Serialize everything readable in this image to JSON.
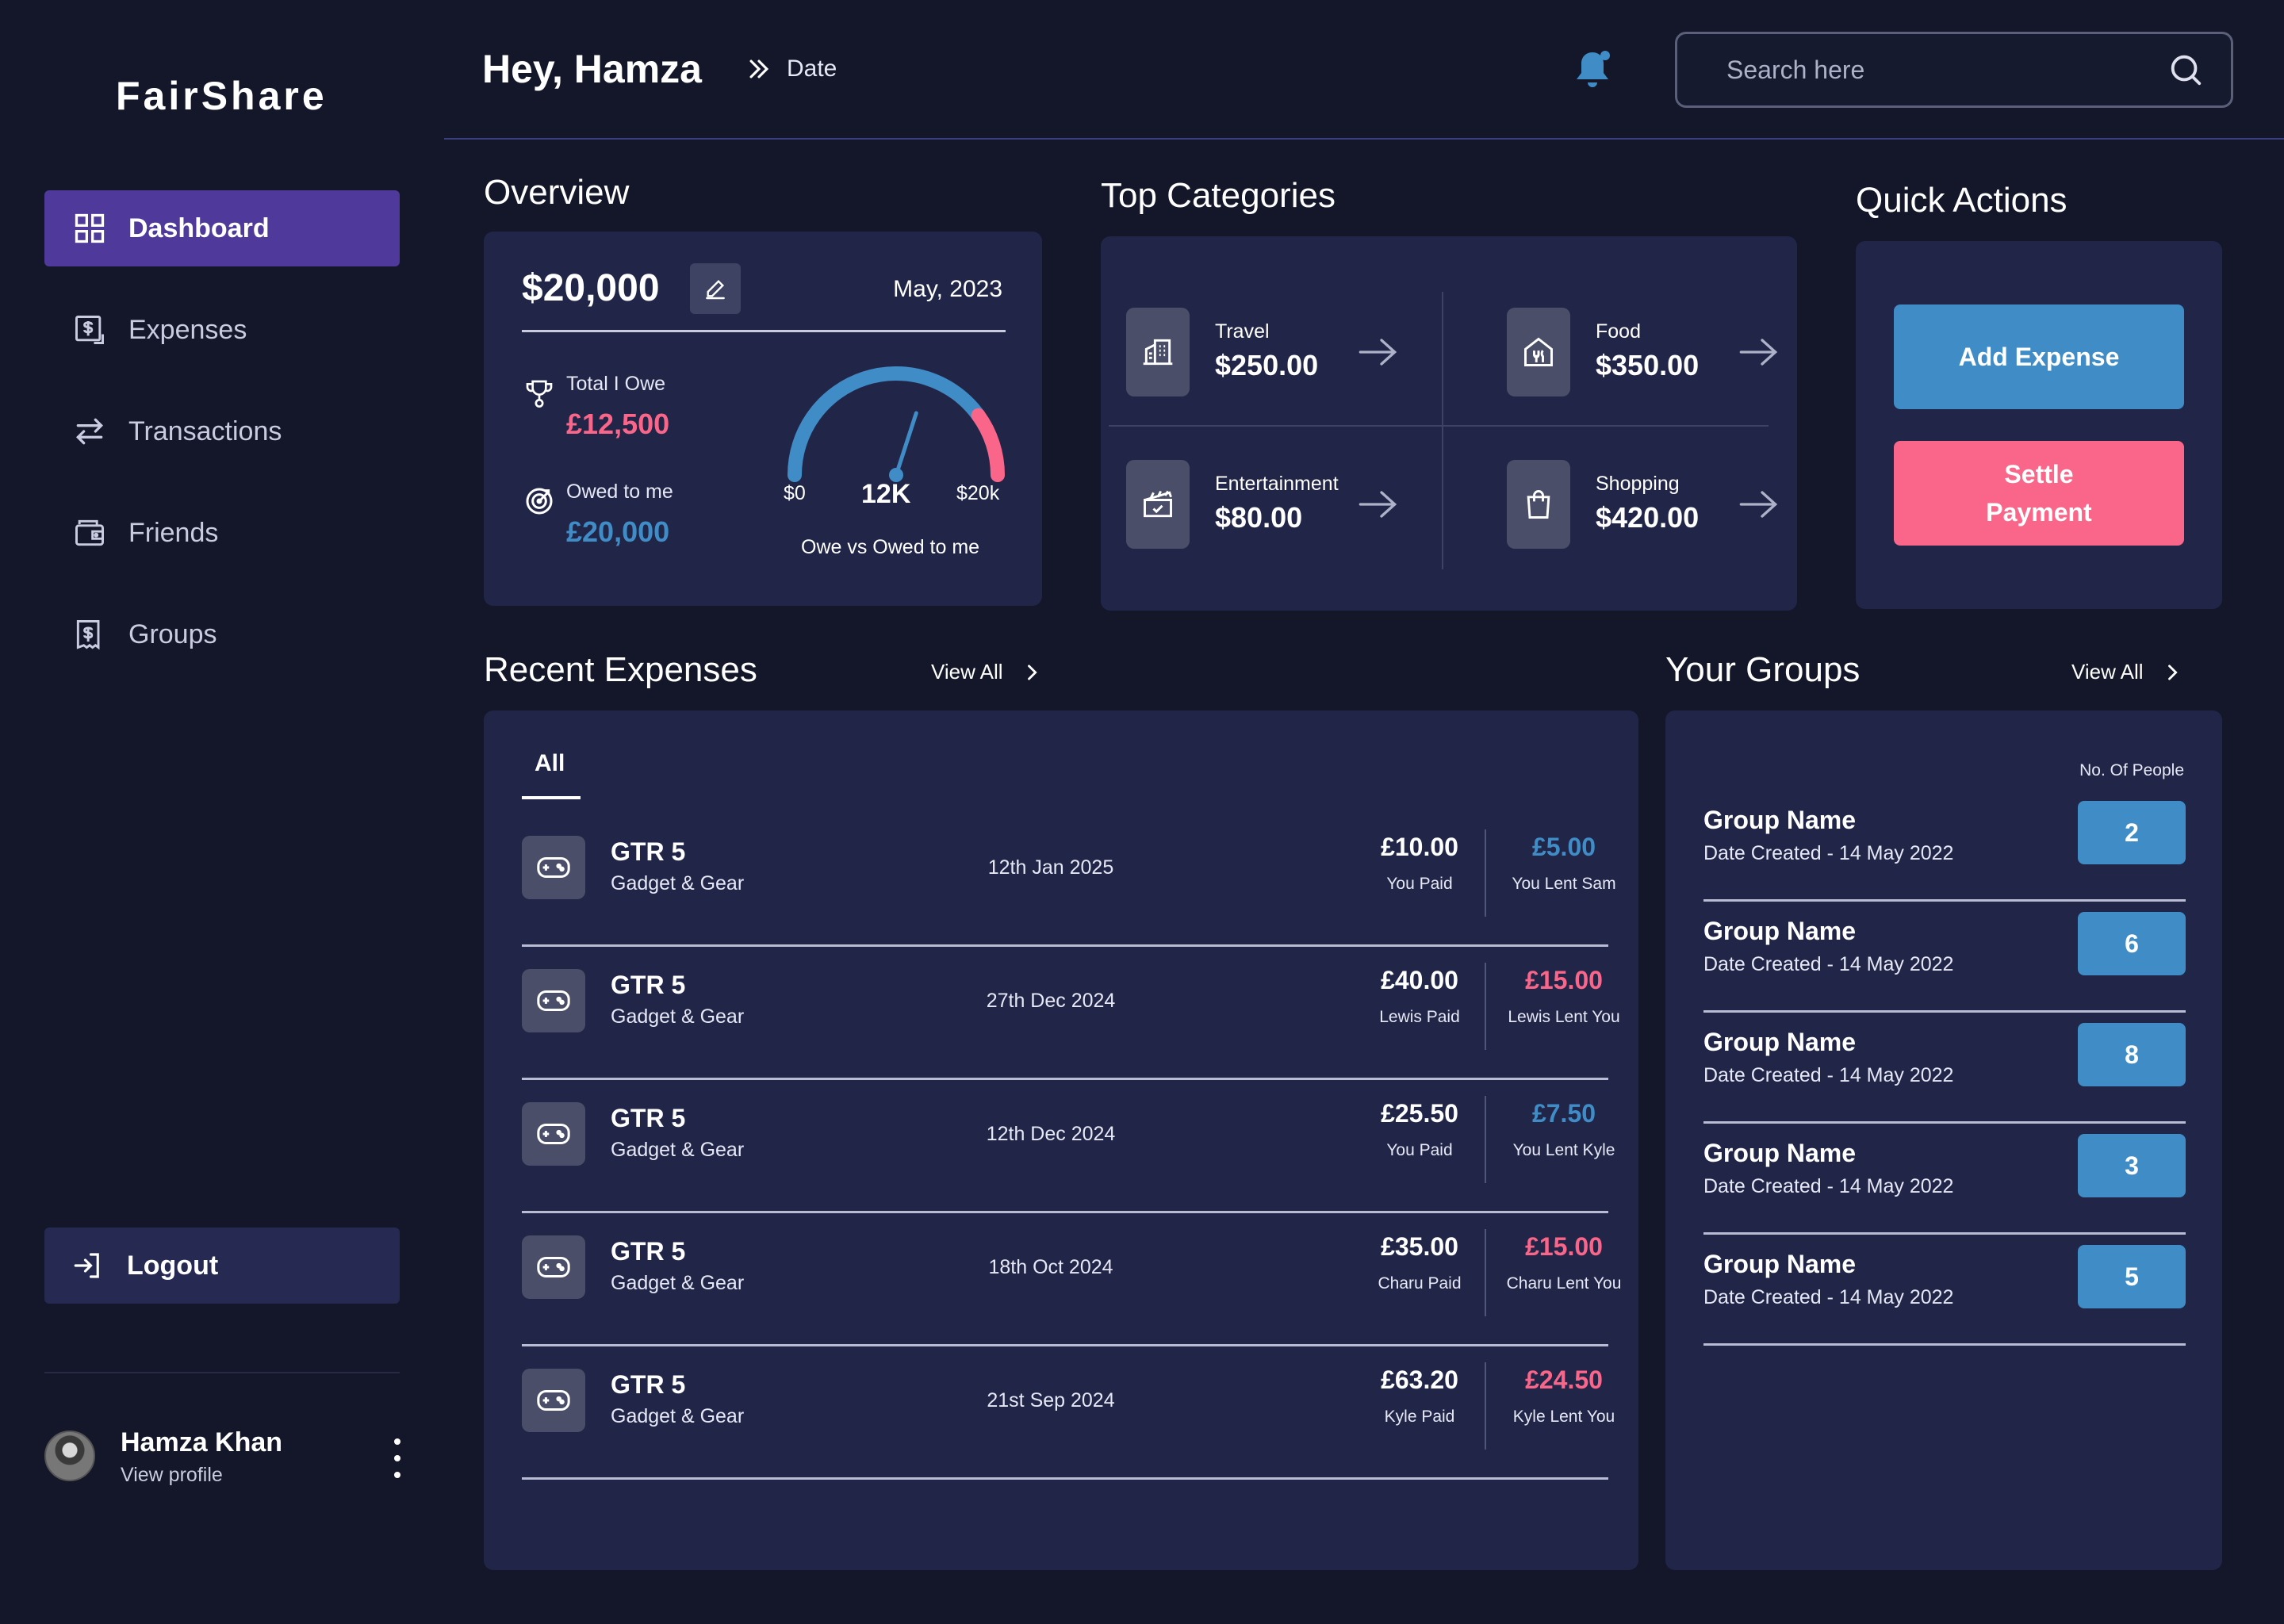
{
  "app": {
    "logo": "FairShare"
  },
  "sidebar": {
    "items": [
      {
        "label": "Dashboard",
        "icon": "grid-icon",
        "active": true
      },
      {
        "label": "Expenses",
        "icon": "receipt-icon"
      },
      {
        "label": "Transactions",
        "icon": "swap-arrows-icon"
      },
      {
        "label": "Friends",
        "icon": "wallet-icon"
      },
      {
        "label": "Groups",
        "icon": "bill-icon"
      }
    ],
    "logout_label": "Logout",
    "profile": {
      "name": "Hamza Khan",
      "link": "View profile"
    }
  },
  "header": {
    "greeting": "Hey, Hamza",
    "breadcrumb": "Date",
    "search_placeholder": "Search here"
  },
  "overview": {
    "title": "Overview",
    "amount": "$20,000",
    "date": "May, 2023",
    "owe_label": "Total I Owe",
    "owe_value": "£12,500",
    "owed_label": "Owed to me",
    "owed_value": "£20,000",
    "gauge": {
      "min_label": "$0",
      "mid_label": "12K",
      "max_label": "$20k",
      "caption": "Owe vs Owed to me",
      "value_fraction": 0.6
    }
  },
  "categories": {
    "title": "Top Categories",
    "items": [
      {
        "name": "Travel",
        "value": "$250.00",
        "icon": "building-icon"
      },
      {
        "name": "Food",
        "value": "$350.00",
        "icon": "restaurant-icon"
      },
      {
        "name": "Entertainment",
        "value": "$80.00",
        "icon": "clapperboard-icon"
      },
      {
        "name": "Shopping",
        "value": "$420.00",
        "icon": "shopping-bag-icon"
      }
    ]
  },
  "quick_actions": {
    "title": "Quick Actions",
    "add_label": "Add Expense",
    "settle_label": "Settle Payment"
  },
  "recent": {
    "title": "Recent Expenses",
    "view_all": "View All",
    "tab": "All",
    "rows": [
      {
        "name": "GTR 5",
        "category": "Gadget & Gear",
        "date": "12th Jan 2025",
        "paid": "£10.00",
        "paid_label": "You Paid",
        "lent": "£5.00",
        "lent_label": "You Lent Sam",
        "lent_color": "#3f8cc6"
      },
      {
        "name": "GTR 5",
        "category": "Gadget & Gear",
        "date": "27th Dec 2024",
        "paid": "£40.00",
        "paid_label": "Lewis Paid",
        "lent": "£15.00",
        "lent_label": "Lewis Lent You",
        "lent_color": "#f9668a"
      },
      {
        "name": "GTR 5",
        "category": "Gadget & Gear",
        "date": "12th Dec 2024",
        "paid": "£25.50",
        "paid_label": "You Paid",
        "lent": "£7.50",
        "lent_label": "You Lent Kyle",
        "lent_color": "#3f8cc6"
      },
      {
        "name": "GTR 5",
        "category": "Gadget & Gear",
        "date": "18th Oct 2024",
        "paid": "£35.00",
        "paid_label": "Charu Paid",
        "lent": "£15.00",
        "lent_label": "Charu Lent You",
        "lent_color": "#f9668a"
      },
      {
        "name": "GTR 5",
        "category": "Gadget & Gear",
        "date": "21st Sep 2024",
        "paid": "£63.20",
        "paid_label": "Kyle Paid",
        "lent": "£24.50",
        "lent_label": "Kyle Lent You",
        "lent_color": "#f9668a"
      }
    ]
  },
  "groups": {
    "title": "Your Groups",
    "view_all": "View All",
    "count_header": "No. Of People",
    "rows": [
      {
        "name": "Group Name",
        "date": "Date Created - 14 May 2022",
        "count": "2"
      },
      {
        "name": "Group Name",
        "date": "Date Created - 14 May 2022",
        "count": "6"
      },
      {
        "name": "Group Name",
        "date": "Date Created - 14 May 2022",
        "count": "8"
      },
      {
        "name": "Group Name",
        "date": "Date Created - 14 May 2022",
        "count": "3"
      },
      {
        "name": "Group Name",
        "date": "Date Created - 14 May 2022",
        "count": "5"
      }
    ]
  },
  "colors": {
    "accent_purple": "#4f3a9c",
    "accent_blue": "#3f8cc6",
    "accent_pink": "#f9668a",
    "card": "#212548",
    "background": "#141729"
  }
}
